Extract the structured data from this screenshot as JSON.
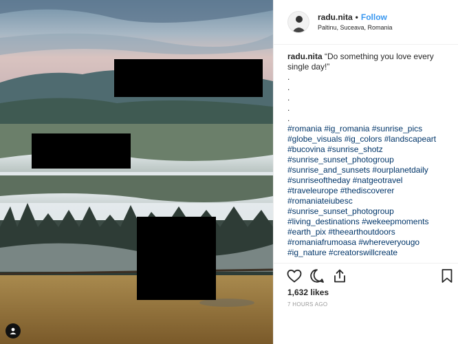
{
  "post": {
    "username": "radu.nita",
    "follow_label": "Follow",
    "separator": "•",
    "location": "Paltinu, Suceava, Romania"
  },
  "caption": {
    "username": "radu.nita",
    "text_line1": "“Do something you love every",
    "text_line2": "single day!”",
    "dots": [
      ".",
      ".",
      ".",
      ".",
      "."
    ],
    "hashtag_lines": [
      "#romania #ig_romania #sunrise_pics",
      "#globe_visuals #ig_colors #landscapeart",
      "#bucovina #sunrise_shotz",
      "#sunrise_sunset_photogroup",
      "#sunrise_and_sunsets #ourplanetdaily",
      "#sunriseoftheday #natgeotravel",
      "#traveleurope #thediscoverer",
      "#romaniateiubesc",
      "#sunrise_sunset_photogroup",
      "#living_destinations #wekeepmoments",
      "#earth_pix #theearthoutdoors",
      "#romaniafrumoasa #whereveryougo",
      "#ig_nature #creatorswillcreate"
    ]
  },
  "likes_text": "1,632 likes",
  "timestamp": "7 HOURS AGO",
  "icons": {
    "like": "heart-icon",
    "comment": "comment-icon",
    "share": "share-icon",
    "save": "bookmark-icon",
    "tagged": "user-tag-icon"
  },
  "colors": {
    "link": "#003569",
    "follow": "#3897f0",
    "muted": "#999999"
  }
}
